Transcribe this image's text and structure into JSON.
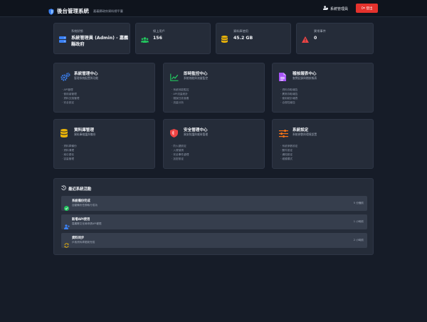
{
  "header": {
    "title": "後台管理系統",
    "subtitle": "嘉義縣政府資料總平臺",
    "user_label": "系統管理員",
    "logout_label": "登出"
  },
  "stats": [
    {
      "label": "系統狀態",
      "value": "系統管理員 (Admin) - 嘉義縣政府",
      "icon": "server-icon",
      "color": "#3b82f6"
    },
    {
      "label": "線上用戶",
      "value": "156",
      "icon": "users-icon",
      "color": "#22c55e"
    },
    {
      "label": "資料庫使用",
      "value": "45.2 GB",
      "icon": "database-icon",
      "color": "#eab308"
    },
    {
      "label": "異常事件",
      "value": "0",
      "icon": "warning-icon",
      "color": "#ef4444"
    }
  ],
  "modules": [
    {
      "title": "系統管理中心",
      "desc": "管理系統配置與功能",
      "icon": "gears-icon",
      "color": "#3b82f6",
      "items": [
        "API管理",
        "使用者管理",
        "資料交換管理",
        "安全設定"
      ]
    },
    {
      "title": "即時監控中心",
      "desc": "系統效能與流量監控",
      "icon": "chart-line-icon",
      "color": "#22c55e",
      "items": [
        "系統效能監控",
        "API流量統計",
        "錯誤日誌查看",
        "流量分析"
      ]
    },
    {
      "title": "稽核報表中心",
      "desc": "查閱記錄與稽核報表",
      "icon": "file-report-icon",
      "color": "#a855f7",
      "items": [
        "資料存取報告",
        "異常存取報告",
        "使用統計報表",
        "合規性報告"
      ]
    },
    {
      "title": "資料庫管理",
      "desc": "資料庫維護與備份",
      "icon": "database-icon",
      "color": "#eab308",
      "items": [
        "資料庫備份",
        "資料清理",
        "索引優化",
        "容量管理"
      ]
    },
    {
      "title": "安全管理中心",
      "desc": "資安防護與威脅管理",
      "icon": "shield-icon",
      "color": "#ef4444",
      "items": [
        "防火牆設定",
        "入侵偵測",
        "安全事件處理",
        "加密設定"
      ]
    },
    {
      "title": "系統設定",
      "desc": "系統參數與環境設置",
      "icon": "sliders-icon",
      "color": "#f97316",
      "items": [
        "系統參數設定",
        "郵件設定",
        "通知設定",
        "維護模式"
      ]
    }
  ],
  "recent": {
    "title": "最近系統活動",
    "items": [
      {
        "title": "系統備份完成",
        "desc": "自動備份任務執行成功",
        "time": "5 分鐘前",
        "icon": "check-circle-icon",
        "color": "#22c55e"
      },
      {
        "title": "新增API使用",
        "desc": "嘉義縣文化局申請API權限",
        "time": "1 小時前",
        "icon": "user-plus-icon",
        "color": "#3b82f6"
      },
      {
        "title": "資料同步",
        "desc": "戶政資料庫更新完成",
        "time": "2 小時前",
        "icon": "sync-icon",
        "color": "#eab308"
      }
    ]
  }
}
